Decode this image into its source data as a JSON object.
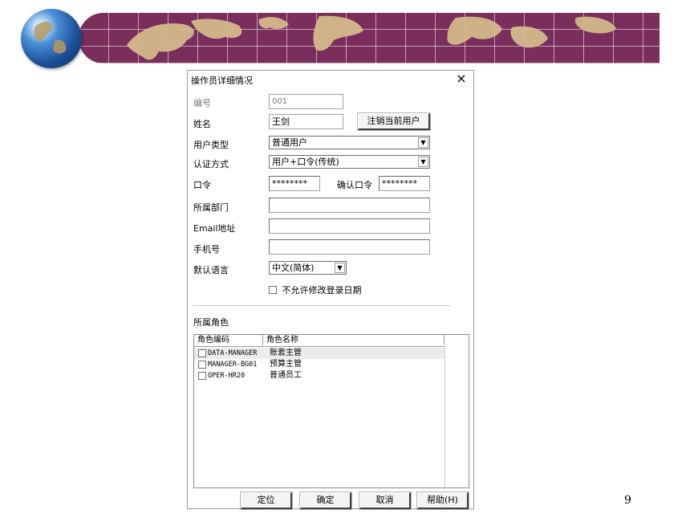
{
  "page_number": "9",
  "colors": {
    "banner": "#7a2e5c",
    "land": "#d4b98a",
    "globe": "#1d4f9a"
  },
  "dialog": {
    "title": "操作员详细情况",
    "close_icon": "×",
    "fields": {
      "id_label": "编号",
      "id_value": "001",
      "name_label": "姓名",
      "name_value": "王剑",
      "logout_button": "注销当前用户",
      "user_type_label": "用户类型",
      "user_type_value": "普通用户",
      "auth_label": "认证方式",
      "auth_value": "用户+口令(传统)",
      "password_label": "口令",
      "password_value": "********",
      "confirm_label": "确认口令",
      "confirm_value": "********",
      "department_label": "所属部门",
      "department_value": "",
      "email_label": "Email地址",
      "email_value": "",
      "mobile_label": "手机号",
      "mobile_value": "",
      "language_label": "默认语言",
      "language_value": "中文(简体)",
      "readonly_checkbox_label": "不允许修改登录日期",
      "readonly_checked": false
    },
    "roles": {
      "section_label": "所属角色",
      "columns": [
        "角色编码",
        "角色名称"
      ],
      "rows": [
        {
          "code": "DATA-MANAGER",
          "name": "账套主管",
          "checked": false
        },
        {
          "code": "MANAGER-BG01",
          "name": "预算主管",
          "checked": false
        },
        {
          "code": "OPER-HR20",
          "name": "普通员工",
          "checked": false
        }
      ]
    },
    "buttons": {
      "locate": "定位",
      "ok": "确定",
      "cancel": "取消",
      "help": "帮助(H)"
    }
  }
}
